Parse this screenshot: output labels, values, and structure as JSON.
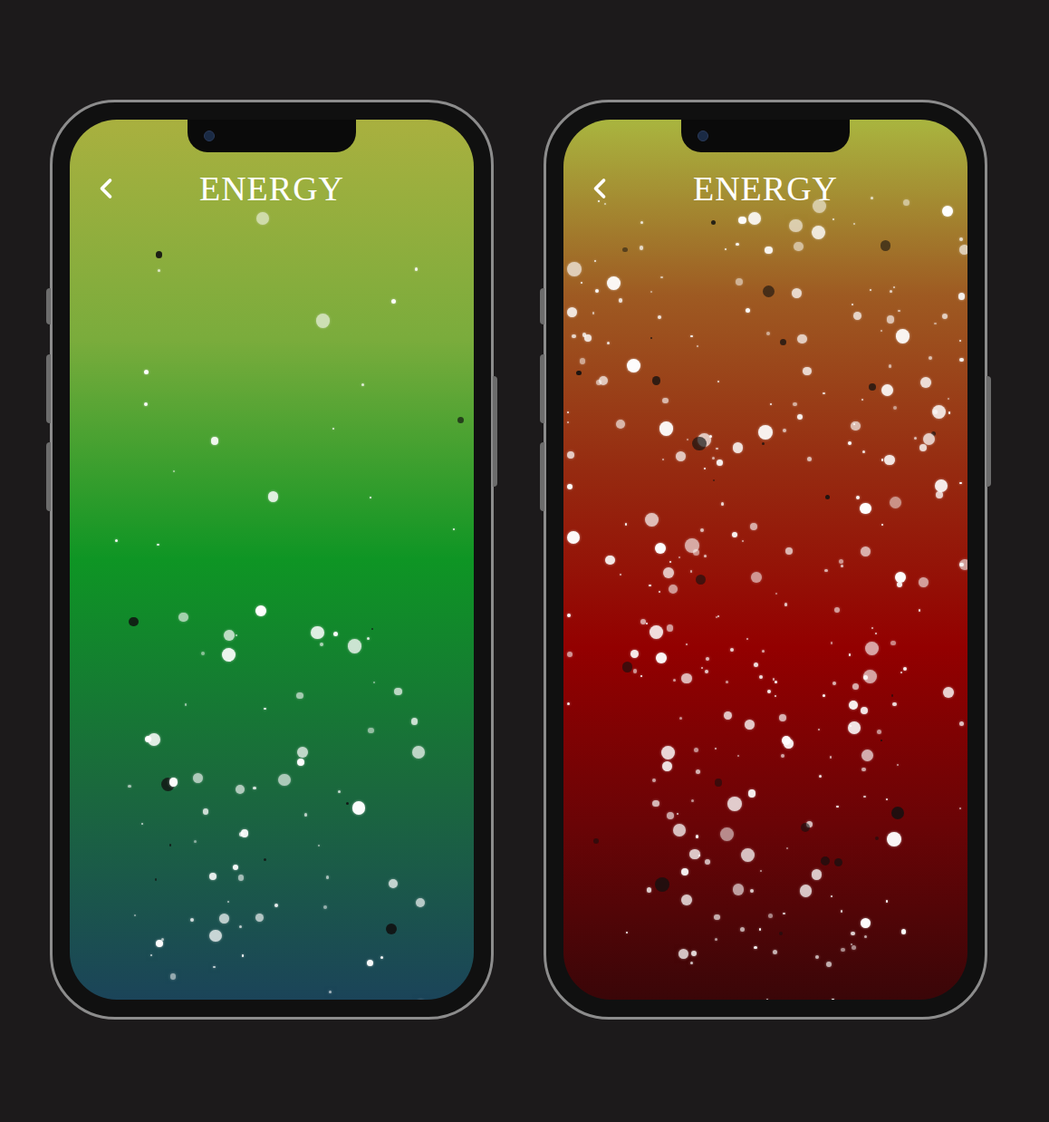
{
  "phones": [
    {
      "title": "ENERGY",
      "level": 0.3,
      "gradient": [
        "#a9b03f",
        "#7aac3c",
        "#0e9524",
        "#1a6a3c",
        "#1b4459"
      ]
    },
    {
      "title": "ENERGY",
      "level": 1,
      "gradient": [
        "#a9b53f",
        "#9e5a22",
        "#962a10",
        "#930000",
        "#6a0406",
        "#3a0608"
      ]
    }
  ]
}
